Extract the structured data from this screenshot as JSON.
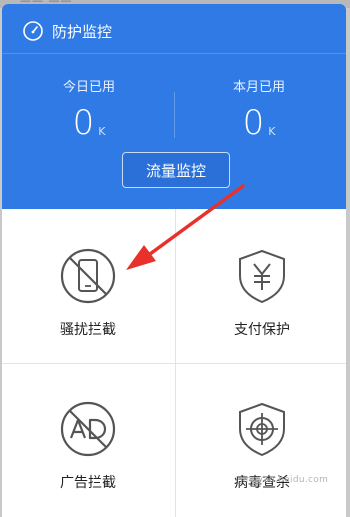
{
  "header": {
    "title": "防护监控",
    "icon": "speedometer-icon"
  },
  "stats": {
    "today_label": "今日已用",
    "today_value": "0",
    "today_unit": "K",
    "month_label": "本月已用",
    "month_value": "0",
    "month_unit": "K"
  },
  "flow_button": "流量监控",
  "features": [
    {
      "label": "骚扰拦截",
      "icon": "no-phone-icon"
    },
    {
      "label": "支付保护",
      "icon": "yuan-shield-icon"
    },
    {
      "label": "广告拦截",
      "icon": "no-ad-icon"
    },
    {
      "label": "病毒查杀",
      "icon": "target-shield-icon"
    }
  ],
  "watermark": "jingyan.baidu.com",
  "colors": {
    "accent": "#2f7ae5",
    "annotation_arrow": "#e8312a",
    "icon_stroke": "#555555"
  }
}
